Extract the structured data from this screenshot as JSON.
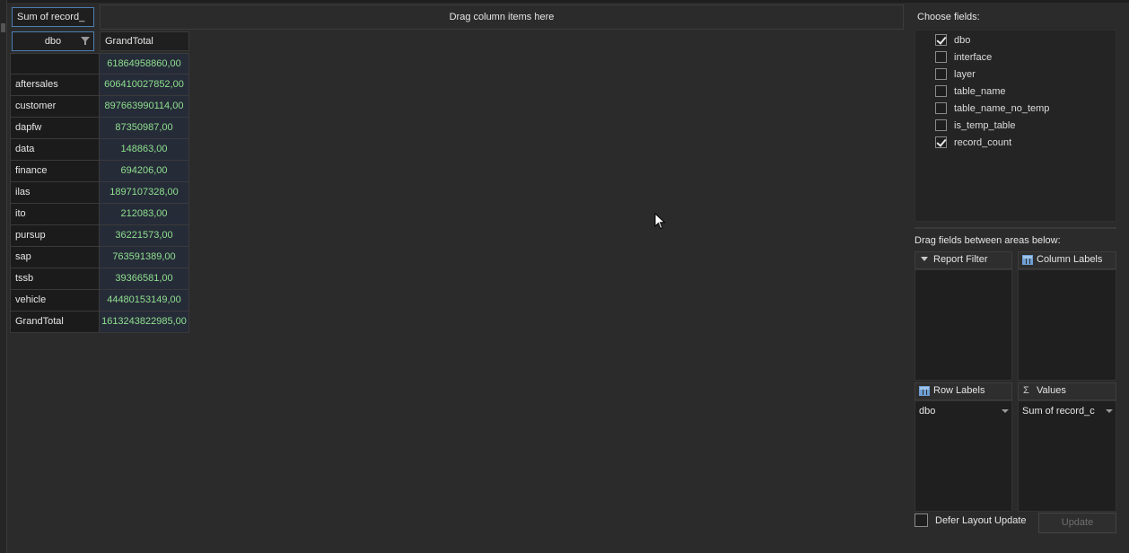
{
  "pivot": {
    "data_field_label": "Sum of record_",
    "column_drop_hint": "Drag column items here",
    "row_field_header": "dbo",
    "grand_total_header": "GrandTotal",
    "rows": [
      {
        "label": "",
        "value": "61864958860,00"
      },
      {
        "label": "aftersales",
        "value": "606410027852,00"
      },
      {
        "label": "customer",
        "value": "897663990114,00"
      },
      {
        "label": "dapfw",
        "value": "87350987,00"
      },
      {
        "label": "data",
        "value": "148863,00"
      },
      {
        "label": "finance",
        "value": "694206,00"
      },
      {
        "label": "ilas",
        "value": "1897107328,00"
      },
      {
        "label": "ito",
        "value": "212083,00"
      },
      {
        "label": "pursup",
        "value": "36221573,00"
      },
      {
        "label": "sap",
        "value": "763591389,00"
      },
      {
        "label": "tssb",
        "value": "39366581,00"
      },
      {
        "label": "vehicle",
        "value": "44480153149,00"
      },
      {
        "label": "GrandTotal",
        "value": "1613243822985,00"
      }
    ]
  },
  "field_list": {
    "choose_fields_label": "Choose fields:",
    "fields": [
      {
        "name": "dbo",
        "checked": true
      },
      {
        "name": "interface",
        "checked": false
      },
      {
        "name": "layer",
        "checked": false
      },
      {
        "name": "table_name",
        "checked": false
      },
      {
        "name": "table_name_no_temp",
        "checked": false
      },
      {
        "name": "is_temp_table",
        "checked": false
      },
      {
        "name": "record_count",
        "checked": true
      }
    ],
    "drag_hint": "Drag fields between areas below:",
    "areas": {
      "report_filter": {
        "title": "Report Filter",
        "icon": "funnel-icon",
        "items": []
      },
      "column_labels": {
        "title": "Column Labels",
        "icon": "grid-columns-icon",
        "items": []
      },
      "row_labels": {
        "title": "Row Labels",
        "icon": "grid-rows-icon",
        "items": [
          "dbo"
        ]
      },
      "values": {
        "title": "Values",
        "icon": "sigma-icon",
        "items": [
          "Sum of record_c"
        ]
      }
    },
    "defer_label": "Defer Layout Update",
    "defer_checked": false,
    "update_label": "Update"
  },
  "colors": {
    "background": "#2b2b2b",
    "value_text": "#8ee08e",
    "value_cell": "#262b38",
    "selection_border": "#4d7fb5"
  }
}
